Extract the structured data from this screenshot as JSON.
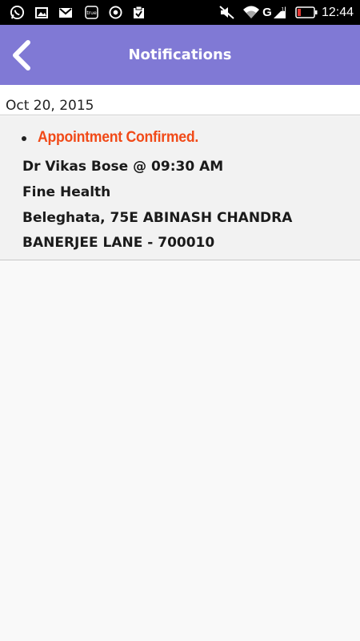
{
  "status_bar": {
    "time": "12:44",
    "icons": [
      "whatsapp-icon",
      "gallery-icon",
      "gmail-icon",
      "truecaller-icon",
      "chrome-icon",
      "clipboard-icon",
      "mute-icon",
      "wifi-icon",
      "signal-icon",
      "battery-icon"
    ],
    "network_label": "G",
    "battery_color": "#e53935"
  },
  "app_bar": {
    "title": "Notifications",
    "color": "#8079d5"
  },
  "notifications": {
    "date": "Oct 20, 2015",
    "items": [
      {
        "title": "Appointment Confirmed.",
        "title_color": "#f14a18",
        "doctor_time": "Dr Vikas Bose @ 09:30 AM",
        "clinic": "Fine Health",
        "address_line1": "Beleghata, 75E ABINASH CHANDRA",
        "address_line2": "BANERJEE LANE - 700010"
      }
    ]
  }
}
